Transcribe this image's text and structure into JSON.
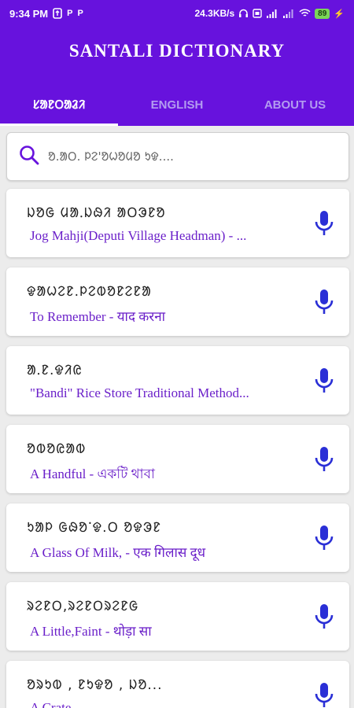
{
  "statusbar": {
    "time": "9:34 PM",
    "speed": "24.3KB/s",
    "battery": "89",
    "icons": [
      "usb-icon",
      "p-notification-icon",
      "p-notification-icon",
      "headphones-icon",
      "sim-icon",
      "signal-icon",
      "signal-icon",
      "wifi-icon",
      "charging-icon"
    ]
  },
  "header": {
    "title": "SANTALI DICTIONARY",
    "tabs": [
      {
        "label": "ᱥᱟᱱᱛᱟᱲᱤ",
        "active": true
      },
      {
        "label": "ENGLISH",
        "active": false
      },
      {
        "label": "ABOUT US",
        "active": false
      }
    ]
  },
  "search": {
    "placeholder": "ᱚ.ᱟᱛ. ᱞᱮ'ᱚᱦᱚᱢᱚ ᱩᱫ....",
    "icon": "search-icon",
    "accent": "#6712dd"
  },
  "entries": [
    {
      "word": "ᱡᱚᱜ ᱢᱟᱹᱡᱷᱤ ᱟᱛᱳᱱᱚ",
      "meaning": "Jog Mahji(Deputi Village Headman) - ..."
    },
    {
      "word": "ᱫᱟᱦᱮᱱ.ᱞᱮᱵᱚᱱᱮᱱᱟ",
      "meaning": "To  Remember - याद करना"
    },
    {
      "word": "ᱟᱹᱱ.ᱫᱤᱭ",
      "meaning": "\"Bandi\" Rice Store Traditional Method..."
    },
    {
      "word": "ᱚᱵᱚᱭᱟᱵ",
      "meaning": "A  Handful - একটি থাবা"
    },
    {
      "word": "ᱩᱟᱞ ᱜᱷᱚᱸᱫ.ᱛ ᱚᱫᱳᱱ",
      "meaning": "A Glass Of Milk, - एक गिलास दूध"
    },
    {
      "word": "ᱨᱮᱱᱛ,ᱨᱮᱱᱛᱨᱮᱱᱜ",
      "meaning": "A Little,Faint - थोड़ा सा"
    },
    {
      "word": "ᱚᱨᱩᱵ , ᱱᱩᱫᱚ , ᱡᱚ...",
      "meaning": "A Crate - ..."
    }
  ],
  "colors": {
    "primary": "#6712dd",
    "meaning_text": "#6a1fc9",
    "mic_icon": "#2a2fd6"
  }
}
